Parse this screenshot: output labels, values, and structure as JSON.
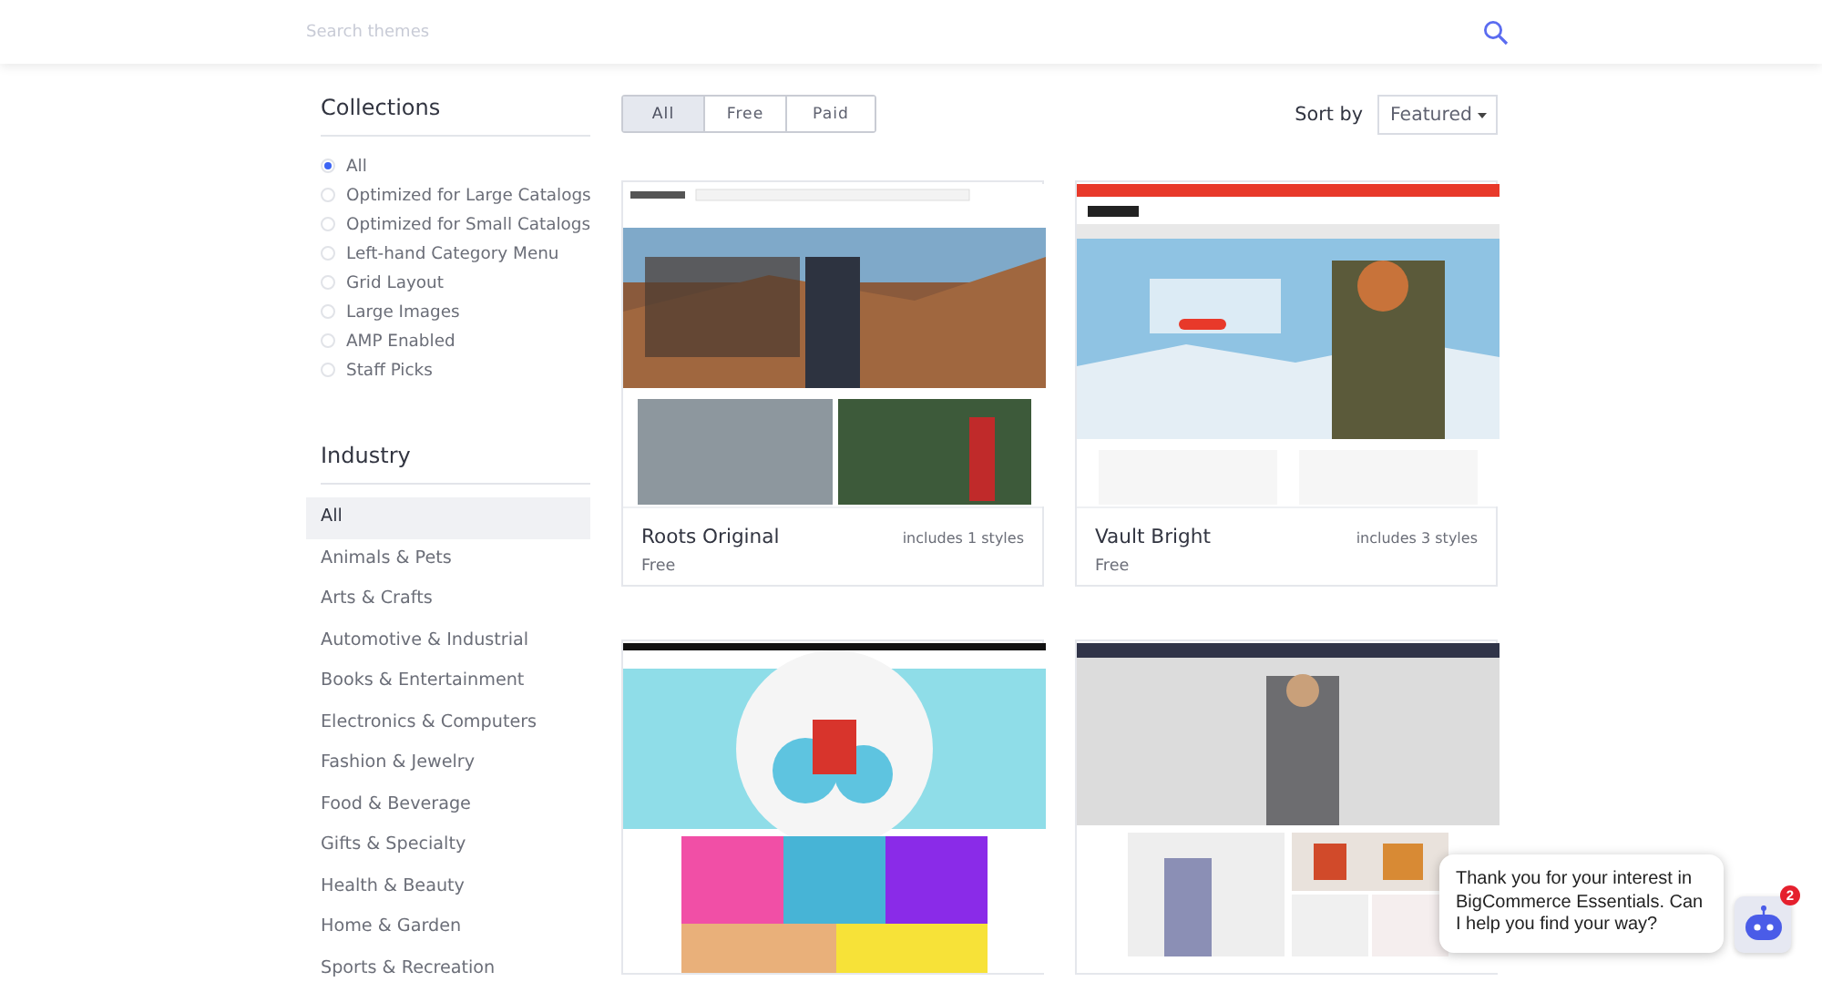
{
  "header": {
    "search": {
      "placeholder": "Search themes"
    }
  },
  "collections": {
    "title": "Collections",
    "items": [
      {
        "label": "All",
        "selected": true
      },
      {
        "label": "Optimized for Large Catalogs",
        "selected": false
      },
      {
        "label": "Optimized for Small Catalogs",
        "selected": false
      },
      {
        "label": "Left-hand Category Menu",
        "selected": false
      },
      {
        "label": "Grid Layout",
        "selected": false
      },
      {
        "label": "Large Images",
        "selected": false
      },
      {
        "label": "AMP Enabled",
        "selected": false
      },
      {
        "label": "Staff Picks",
        "selected": false
      }
    ]
  },
  "industry": {
    "title": "Industry",
    "items": [
      {
        "label": "All",
        "selected": true
      },
      {
        "label": "Animals & Pets",
        "selected": false
      },
      {
        "label": "Arts & Crafts",
        "selected": false
      },
      {
        "label": "Automotive & Industrial",
        "selected": false
      },
      {
        "label": "Books & Entertainment",
        "selected": false
      },
      {
        "label": "Electronics & Computers",
        "selected": false
      },
      {
        "label": "Fashion & Jewelry",
        "selected": false
      },
      {
        "label": "Food & Beverage",
        "selected": false
      },
      {
        "label": "Gifts & Specialty",
        "selected": false
      },
      {
        "label": "Health & Beauty",
        "selected": false
      },
      {
        "label": "Home & Garden",
        "selected": false
      },
      {
        "label": "Sports & Recreation",
        "selected": false
      }
    ]
  },
  "filter_tabs": [
    {
      "label": "All",
      "selected": true
    },
    {
      "label": "Free",
      "selected": false
    },
    {
      "label": "Paid",
      "selected": false
    }
  ],
  "sort": {
    "label": "Sort by",
    "value": "Featured"
  },
  "themes": [
    {
      "kind": "outdoor",
      "name": "Roots Original",
      "styles": "includes 1 styles",
      "price": "Free"
    },
    {
      "kind": "winter",
      "name": "Vault Bright",
      "styles": "includes 3 styles",
      "price": "Free"
    },
    {
      "kind": "toys"
    },
    {
      "kind": "fashion"
    }
  ],
  "chat": {
    "message": "Thank you for your interest in BigCommerce Essentials. Can I help you find your way?",
    "badge": "2"
  }
}
